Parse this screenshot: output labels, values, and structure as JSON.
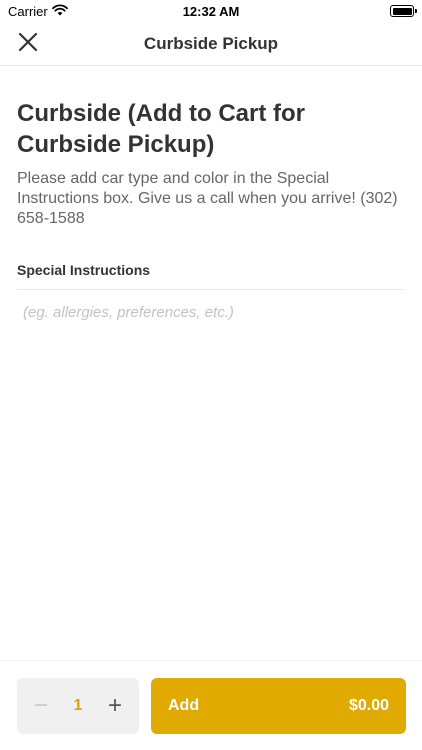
{
  "status_bar": {
    "carrier": "Carrier",
    "time": "12:32 AM"
  },
  "nav": {
    "title": "Curbside Pickup"
  },
  "item": {
    "title": "Curbside (Add to Cart for Curbside Pickup)",
    "description": "Please add car type and color in the Special Instructions box. Give us a call when you arrive! (302) 658-1588"
  },
  "instructions": {
    "label": "Special Instructions",
    "placeholder": "(eg. allergies, preferences, etc.)",
    "value": ""
  },
  "footer": {
    "quantity": "1",
    "minus_symbol": "−",
    "plus_symbol": "+",
    "add_label": "Add",
    "price": "$0.00"
  },
  "colors": {
    "accent": "#e0aa00",
    "quantity_text": "#d9a400",
    "stepper_bg": "#f0f0f0"
  },
  "icons": {
    "wifi": "wifi-icon",
    "battery": "battery-icon",
    "close": "close-icon"
  }
}
